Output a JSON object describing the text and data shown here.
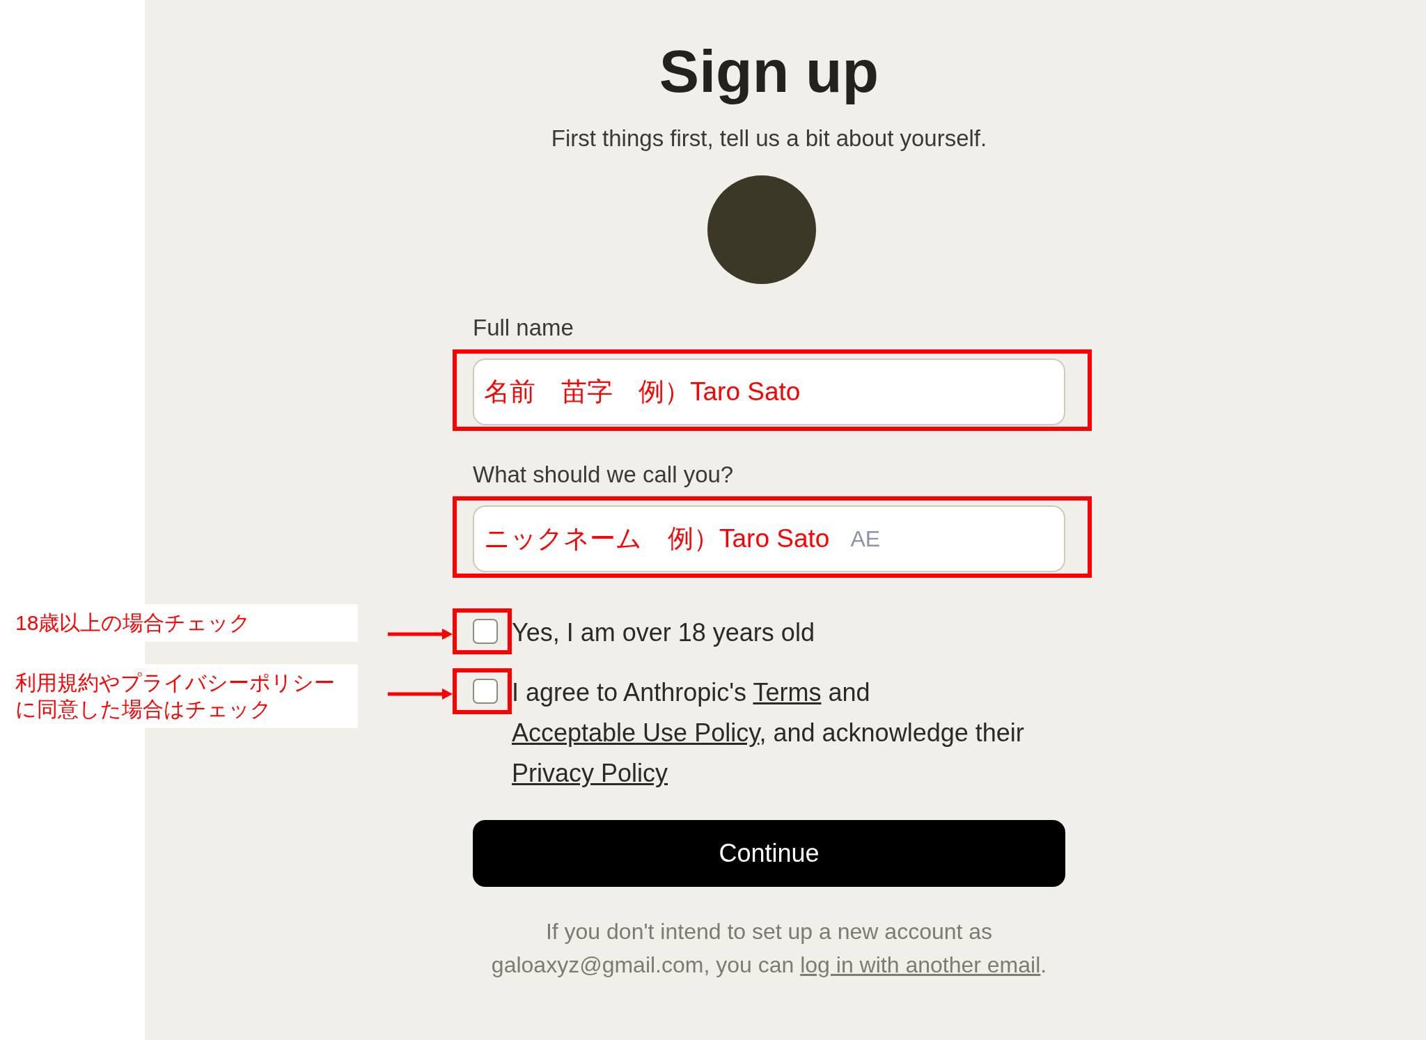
{
  "heading": "Sign up",
  "subtitle": "First things first, tell us a bit about yourself.",
  "fields": [
    {
      "label": "Full name",
      "value": "名前　苗字　例）Taro Sato",
      "highlighted": true
    },
    {
      "label": "What should we call you?",
      "value": "ニックネーム　例）Taro Sato",
      "hint": "AE",
      "highlighted": true
    }
  ],
  "checkboxes": [
    {
      "checked": false,
      "highlighted": true,
      "parts": [
        {
          "text": "Yes, I am over 18 years old",
          "link": false
        }
      ],
      "annotation": [
        "18歳以上の場合チェック"
      ]
    },
    {
      "checked": false,
      "highlighted": true,
      "parts": [
        {
          "text": "I agree to Anthropic's ",
          "link": false
        },
        {
          "text": "Terms",
          "link": true
        },
        {
          "text": " and ",
          "link": false
        },
        {
          "text": "Acceptable Use Policy",
          "link": true
        },
        {
          "text": ", and acknowledge their ",
          "link": false
        },
        {
          "text": "Privacy Policy",
          "link": true
        }
      ],
      "annotation": [
        "利用規約やプライバシーポリシー",
        "に同意した場合はチェック"
      ]
    }
  ],
  "button": "Continue",
  "footer": [
    {
      "text": "If you don't intend to set up a new account as galoaxyz@gmail.com, you can ",
      "link": false
    },
    {
      "text": "log in with another email",
      "link": true
    },
    {
      "text": ".",
      "link": false
    }
  ]
}
